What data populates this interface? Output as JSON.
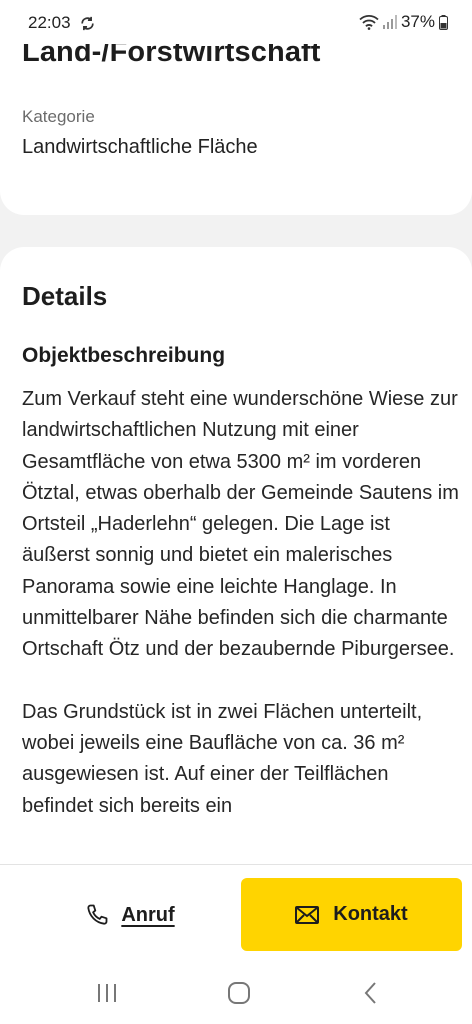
{
  "status_bar": {
    "time": "22:03",
    "battery": "37%",
    "icons": [
      "sync-icon",
      "wifi-icon",
      "signal-icon",
      "battery-icon"
    ]
  },
  "listing": {
    "title": "Land-/Forstwirtschaft",
    "category_label": "Kategorie",
    "category_value": "Landwirtschaftliche Fläche"
  },
  "details": {
    "heading": "Details",
    "object_heading": "Objektbeschreibung",
    "paragraphs": [
      "Zum Verkauf steht eine wunderschöne Wiese zur landwirtschaftlichen Nutzung mit einer Gesamtfläche von etwa 5300 m² im vorderen Ötztal, etwas oberhalb der Gemeinde Sautens im Ortsteil „Haderlehn“ gelegen. Die Lage ist äußerst sonnig und bietet ein malerisches Panorama sowie eine leichte Hanglage. In unmittelbarer Nähe befinden sich die charmante Ortschaft Ötz und der bezaubernde Piburgersee.",
      "Das Grundstück ist in zwei Flächen unterteilt, wobei jeweils eine Baufläche von ca. 36 m² ausgewiesen ist. Auf einer der Teilflächen befindet sich bereits ein"
    ]
  },
  "actions": {
    "call_label": "Anruf",
    "contact_label": "Kontakt",
    "accent_color": "#FFD400"
  },
  "nav": {
    "icons": [
      "recent-apps-icon",
      "home-icon",
      "back-icon"
    ]
  }
}
